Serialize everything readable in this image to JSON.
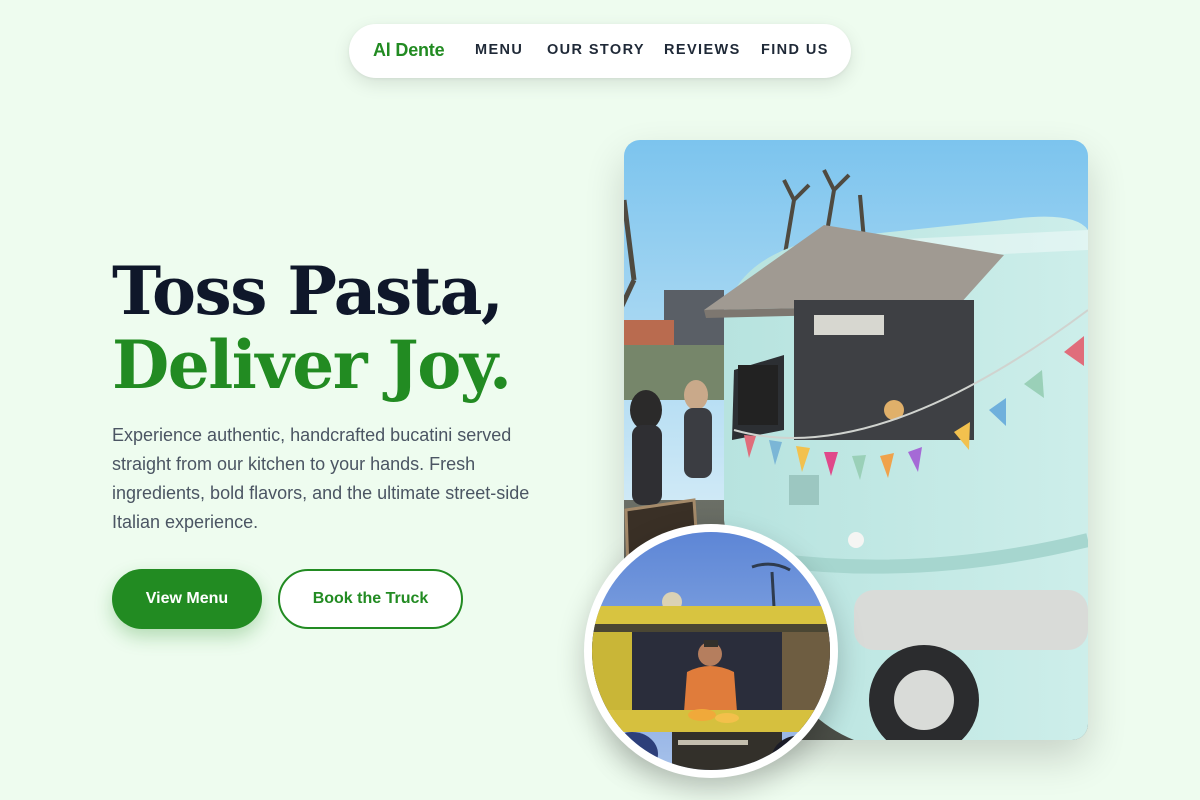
{
  "nav": {
    "brand": "Al Dente",
    "links": [
      "MENU",
      "OUR STORY",
      "REVIEWS",
      "FIND US"
    ]
  },
  "hero": {
    "headline_line1": "Toss Pasta,",
    "headline_line2": "Deliver Joy.",
    "description": "Experience authentic, handcrafted bucatini served straight from our kitchen to your hands. Fresh ingredients, bold flavors, and the ultimate street-side Italian experience.",
    "primary_cta": "View Menu",
    "secondary_cta": "Book the Truck"
  },
  "images": {
    "main_photo": "food-truck-photo",
    "inset_photo": "chef-at-night-stall-photo"
  },
  "colors": {
    "brand_green": "#228b22",
    "background": "#eefcef",
    "heading_dark": "#0f172a",
    "body_text": "#4b5563"
  }
}
